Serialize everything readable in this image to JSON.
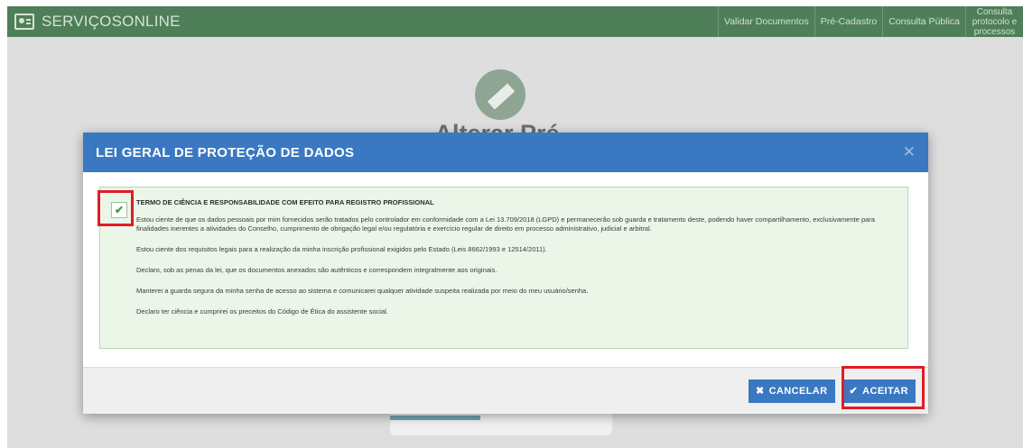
{
  "app": {
    "name": "SERVIÇOSONLINE",
    "logo_icon": "id-card-icon"
  },
  "nav": {
    "items": [
      {
        "label": "Validar Documentos"
      },
      {
        "label": "Pré-Cadastro"
      },
      {
        "label": "Consulta Pública"
      },
      {
        "label": "Consulta protocolo e processos"
      }
    ]
  },
  "background": {
    "title": "Alterar Pré-cadastro",
    "avatar_icon": "edit-user-icon"
  },
  "modal": {
    "title": "LEI GERAL DE PROTEÇÃO DE DADOS",
    "close_symbol": "✕",
    "checkbox_checked": true,
    "check_symbol": "✔",
    "terms_heading": "TERMO DE CIÊNCIA E RESPONSABILIDADE COM EFEITO PARA REGISTRO PROFISSIONAL",
    "paragraphs": [
      "Estou ciente de que os dados pessoais por mim fornecidos serão tratados pelo controlador em conformidade com a Lei 13.709/2018 (LGPD) e permanecerão sob guarda e tratamento deste, podendo haver compartilhamento, exclusivamente para finalidades inerentes a atividades do Conselho, cumprimento de obrigação legal e/ou regulatória e exercício regular de direito em processo administrativo, judicial e arbitral.",
      "Estou ciente dos requisitos legais para a realização da minha inscrição profissional exigidos pelo Estado (Leis 8662/1993 e 12514/2011).",
      "Declaro, sob as penas da lei, que os documentos anexados são autênticos e correspondem integralmente aos originais.",
      "Manterei a guarda segura da minha senha de acesso ao sistema e comunicarei qualquer atividade suspeita realizada por meio do meu usuário/senha.",
      "Declaro ter ciência e cumprirei os preceitos do Código de Ética do assistente social."
    ],
    "cancel_label": "CANCELAR",
    "cancel_icon": "✖",
    "accept_label": "ACEITAR",
    "accept_icon": "✔"
  },
  "colors": {
    "topbar": "#4f7f58",
    "modal_header": "#3a78c2",
    "button": "#3a78c2",
    "terms_background": "#ebf6e9",
    "highlight": "#e01c24"
  }
}
